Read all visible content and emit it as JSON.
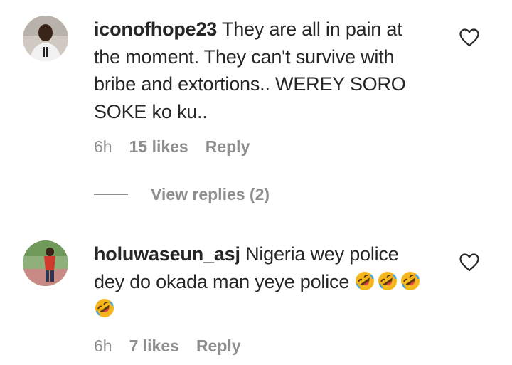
{
  "comments": [
    {
      "username": "iconofhope23",
      "text": "They are all in pain at the moment. They can't survive with bribe and extortions.. WEREY SORO SOKE ko ku..",
      "time": "6h",
      "likes": "15 likes",
      "reply": "Reply",
      "avatar_icon": "user-avatar",
      "like_icon": "heart-outline-icon"
    },
    {
      "username": "holuwaseun_asj",
      "text": "Nigeria wey police dey do okada man yeye police",
      "emoji_icon": "rolling-on-floor-laughing-emoji",
      "emoji_count": 4,
      "time": "6h",
      "likes": "7 likes",
      "reply": "Reply",
      "avatar_icon": "user-avatar",
      "like_icon": "heart-outline-icon"
    }
  ],
  "view_replies": "View replies (2)",
  "colors": {
    "text": "#262626",
    "muted": "#8e8e8e",
    "emoji_face": "#f5b51c"
  }
}
